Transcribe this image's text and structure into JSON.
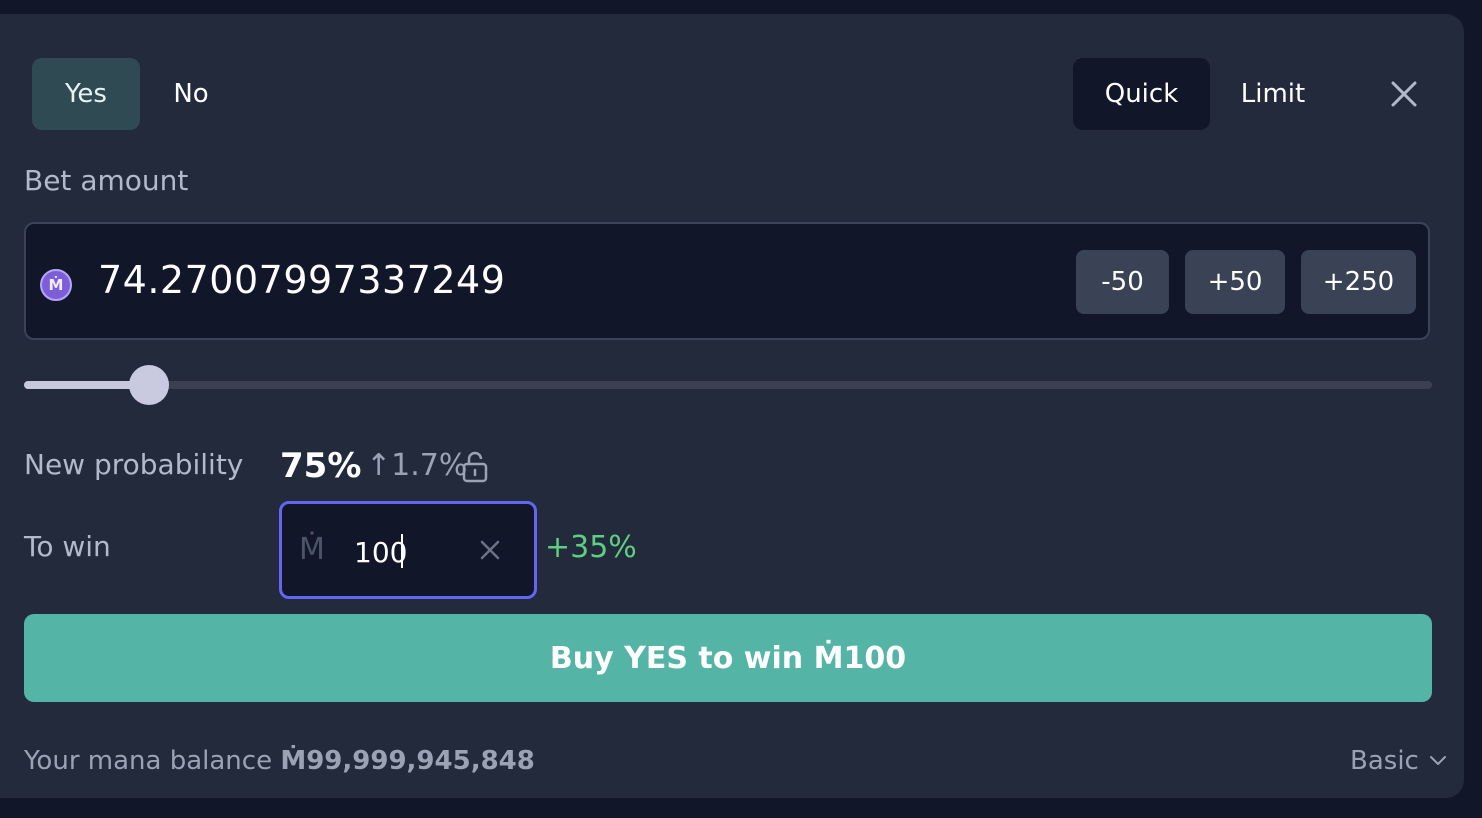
{
  "outcome_tabs": {
    "yes": "Yes",
    "no": "No",
    "selected": "Yes"
  },
  "mode_tabs": {
    "quick": "Quick",
    "limit": "Limit",
    "selected": "Quick"
  },
  "bet": {
    "label": "Bet amount",
    "coin_symbol": "Ṁ",
    "amount": "74.27007997337249",
    "buttons": {
      "minus50": "-50",
      "plus50": "+50",
      "plus250": "+250"
    },
    "slider_fraction": 0.09
  },
  "probability": {
    "label": "New probability",
    "value": "75%",
    "change": "↑1.7%"
  },
  "to_win": {
    "label": "To win",
    "currency": "Ṁ",
    "value": "100",
    "pct": "+35%"
  },
  "buy_button": "Buy YES to win Ṁ100",
  "footer": {
    "balance_label": "Your mana balance",
    "balance_value": "Ṁ99,999,945,848",
    "mode_dropdown": "Basic"
  },
  "icons": [
    "close-icon",
    "mana-coin-icon",
    "lock-icon",
    "clear-icon",
    "chevron-down-icon"
  ],
  "colors": {
    "accent": "#54b5a6",
    "focus": "#6366f1",
    "positive": "#5dce82",
    "yes_tab": "#2f4a52"
  }
}
